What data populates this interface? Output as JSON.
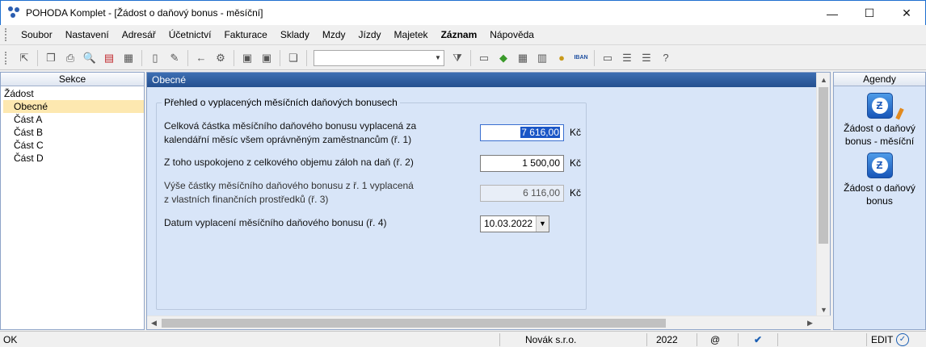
{
  "window": {
    "title": "POHODA Komplet - [Žádost o daňový bonus - měsíční]",
    "minimize_glyph": "—",
    "maximize_glyph": "☐",
    "close_glyph": "✕"
  },
  "menu": [
    "Soubor",
    "Nastavení",
    "Adresář",
    "Účetnictví",
    "Fakturace",
    "Sklady",
    "Mzdy",
    "Jízdy",
    "Majetek",
    "Záznam",
    "Nápověda"
  ],
  "toolbar": {
    "combo_value": "",
    "iban_label": "IBAN"
  },
  "left_panel": {
    "header": "Sekce",
    "root": "Žádost",
    "items": [
      "Obecné",
      "Část A",
      "Část B",
      "Část C",
      "Část D"
    ],
    "selected": "Obecné"
  },
  "content": {
    "header": "Obecné",
    "group_title": "Přehled o vyplacených měsíčních daňových bonusech",
    "fields": [
      {
        "label_1": "Celková částka měsíčního daňového bonusu vyplacená za",
        "label_2": "kalendářní měsíc všem oprávněným zaměstnancům (ř. 1)",
        "value": "7 616,00",
        "unit": "Kč"
      },
      {
        "label_1": "Z toho uspokojeno z celkového objemu záloh na daň (ř. 2)",
        "value": "1 500,00",
        "unit": "Kč"
      },
      {
        "label_1": "Výše částky měsíčního daňového bonusu z ř. 1 vyplacená",
        "label_2": "z vlastních finančních prostředků (ř. 3)",
        "value": "6 116,00",
        "unit": "Kč"
      },
      {
        "label_1": "Datum vyplacení měsíčního daňového bonusu (ř. 4)",
        "value": "10.03.2022"
      }
    ]
  },
  "right_panel": {
    "header": "Agendy",
    "items": [
      {
        "line_1": "Žádost o daňový",
        "line_2": "bonus - měsíční"
      },
      {
        "line_1": "Žádost o daňový",
        "line_2": "bonus"
      }
    ]
  },
  "statusbar": {
    "state": "OK",
    "company": "Novák s.r.o.",
    "year": "2022",
    "at_symbol": "@",
    "mode": "EDIT"
  },
  "colors": {
    "content_bg": "#d8e5f8",
    "header_blue": "#2f5fa1",
    "selection": "#fde8b0"
  }
}
